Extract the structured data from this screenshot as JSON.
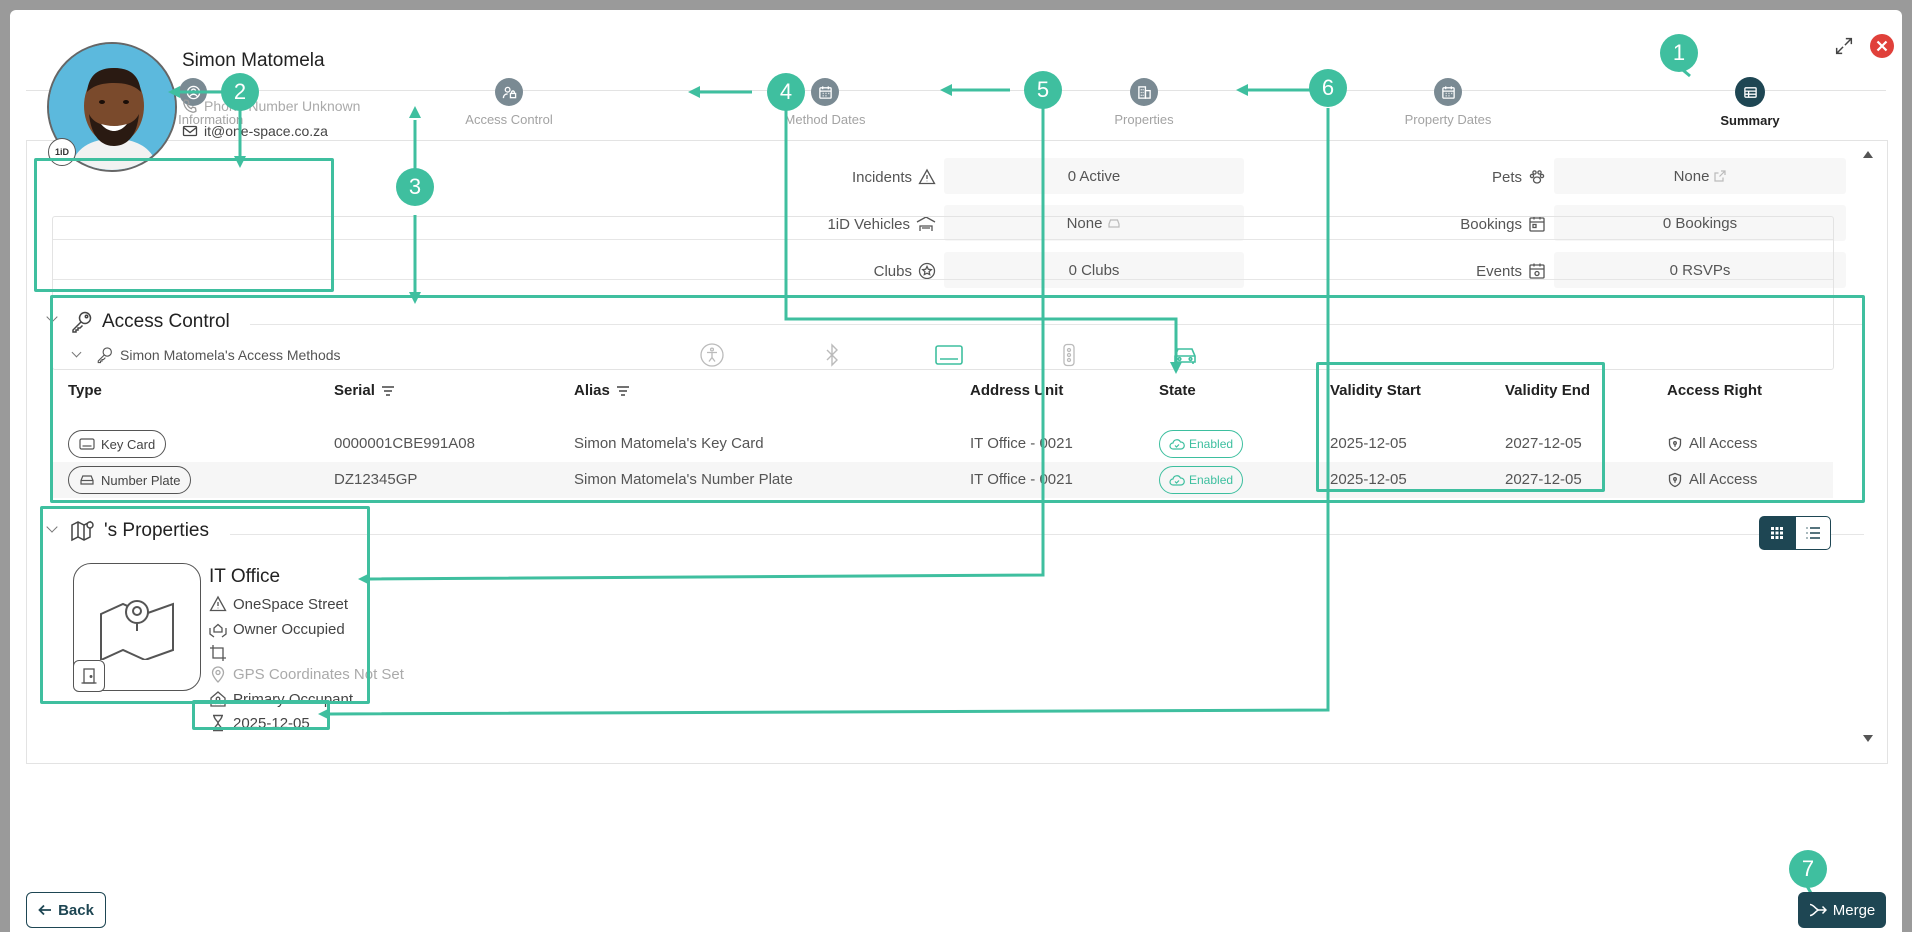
{
  "stepper": {
    "steps": [
      {
        "label": "Basic Information",
        "icon": "user-circle-icon"
      },
      {
        "label": "Access Control",
        "icon": "user-lock-icon"
      },
      {
        "label": "Method Dates",
        "icon": "calendar-icon"
      },
      {
        "label": "Properties",
        "icon": "buildings-icon"
      },
      {
        "label": "Property Dates",
        "icon": "calendar-icon"
      },
      {
        "label": "Summary",
        "icon": "table-icon"
      }
    ],
    "active": "Summary"
  },
  "person": {
    "name": "Simon Matomela",
    "phone": "Phone Number Unknown",
    "email": "it@one-space.co.za",
    "badge": "1iD"
  },
  "stats_left": [
    {
      "label": "Incidents",
      "value": "0 Active"
    },
    {
      "label": "1iD Vehicles",
      "value": "None"
    },
    {
      "label": "Clubs",
      "value": "0 Clubs"
    }
  ],
  "stats_right": [
    {
      "label": "Pets",
      "value": "None"
    },
    {
      "label": "Bookings",
      "value": "0 Bookings"
    },
    {
      "label": "Events",
      "value": "0 RSVPs"
    }
  ],
  "access_control": {
    "title": "Access Control",
    "methods_title": "Simon Matomela's Access Methods",
    "columns": [
      "Type",
      "Serial",
      "Alias",
      "Address Unit",
      "State",
      "Validity Start",
      "Validity End",
      "Access Right"
    ],
    "rows": [
      {
        "type": "Key Card",
        "serial": "0000001CBE991A08",
        "alias": "Simon Matomela's Key Card",
        "unit": "IT Office - 0021",
        "state": "Enabled",
        "start": "2025-12-05",
        "end": "2027-12-05",
        "right": "All Access"
      },
      {
        "type": "Number Plate",
        "serial": "DZ12345GP",
        "alias": "Simon Matomela's Number Plate",
        "unit": "IT Office - 0021",
        "state": "Enabled",
        "start": "2025-12-05",
        "end": "2027-12-05",
        "right": "All Access"
      }
    ]
  },
  "properties": {
    "title": "'s Properties",
    "item": {
      "name": "IT Office",
      "street": "OneSpace Street",
      "occupancy": "Owner Occupied",
      "gps": "GPS Coordinates Not Set",
      "role": "Primary Occupant",
      "date": "2025-12-05"
    }
  },
  "annotations": [
    "1",
    "2",
    "3",
    "4",
    "5",
    "6",
    "7"
  ],
  "footer": {
    "back": "Back",
    "merge": "Merge"
  },
  "colors": {
    "accent": "#3fbf9f",
    "primary": "#1e4653",
    "close": "#e0403a"
  }
}
